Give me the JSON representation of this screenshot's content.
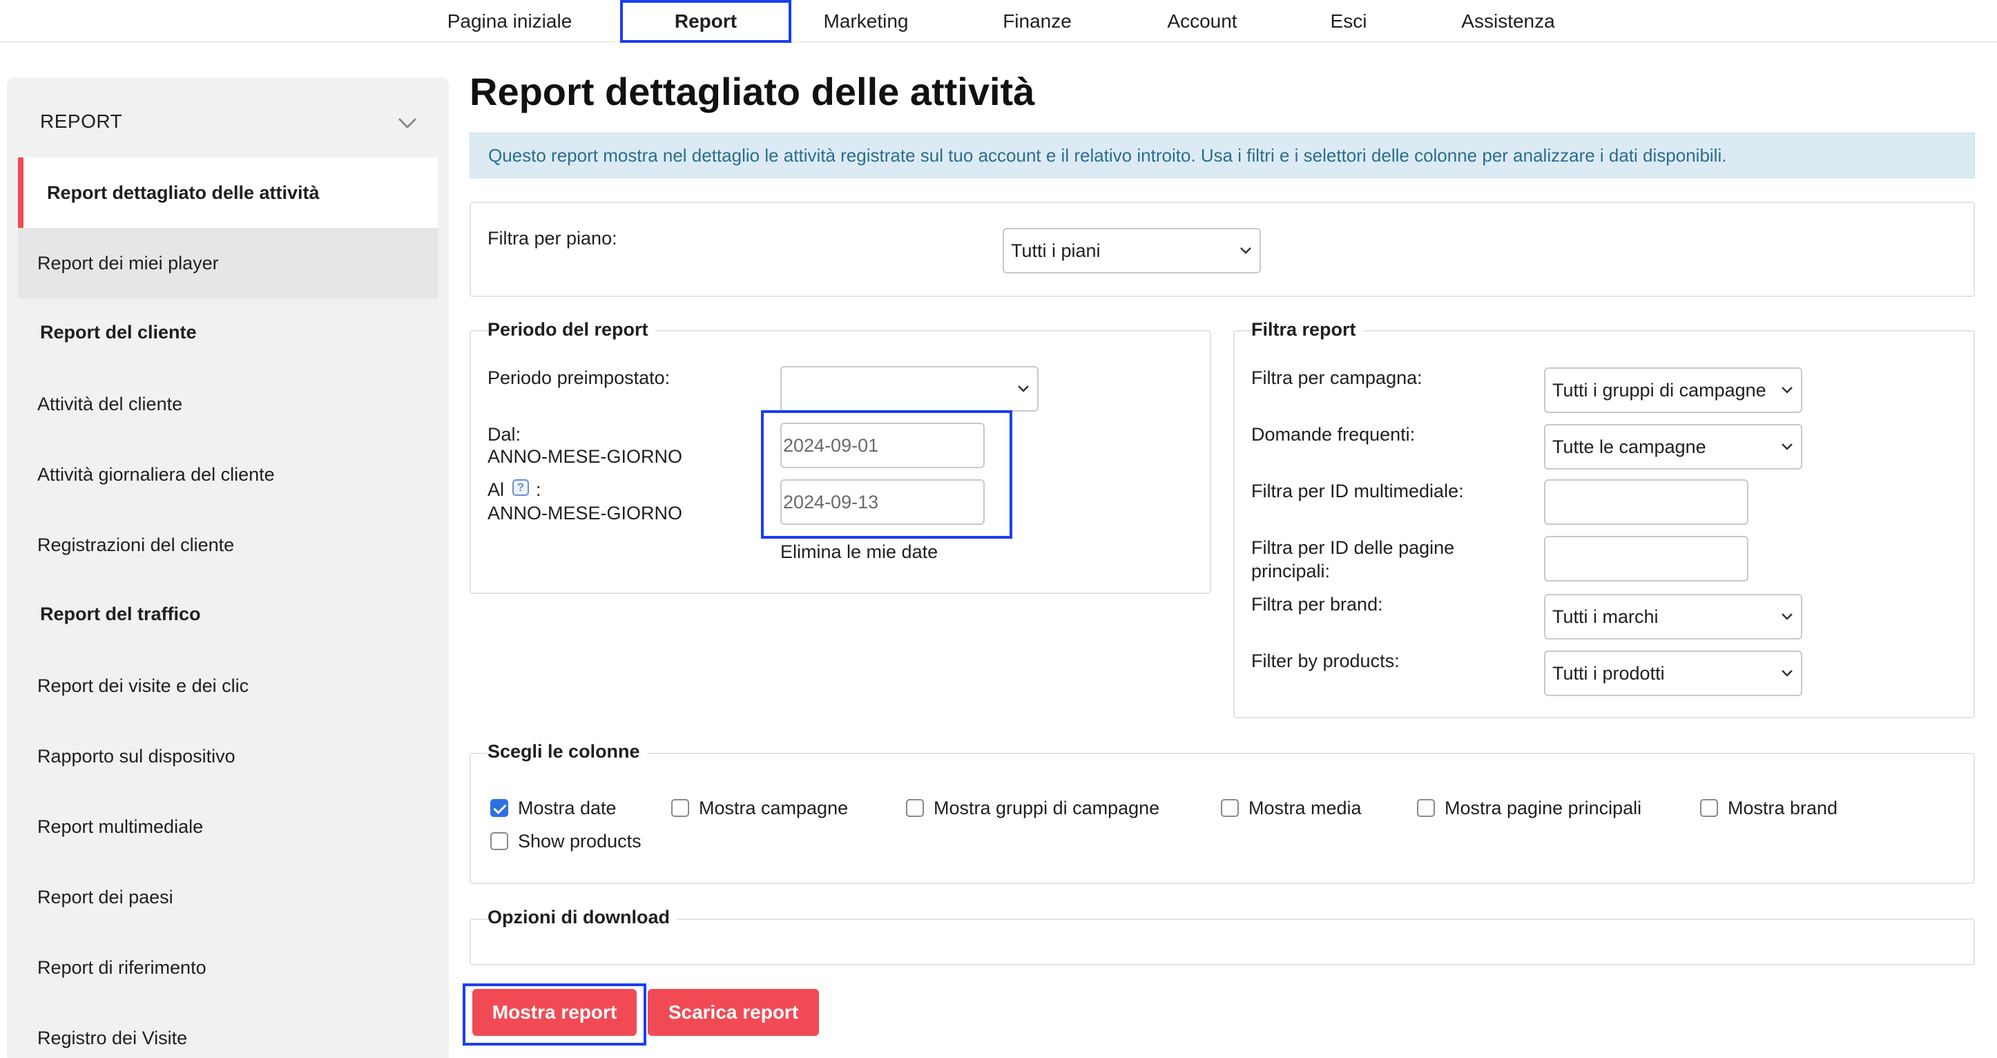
{
  "topnav": {
    "items": [
      "Pagina iniziale",
      "Report",
      "Marketing",
      "Finanze",
      "Account",
      "Esci",
      "Assistenza"
    ],
    "active": "Report"
  },
  "sidebar": {
    "header": "REPORT",
    "items": [
      {
        "label": "Report dettagliato delle attività"
      },
      {
        "label": "Report dei miei player"
      },
      {
        "label": "Report del cliente"
      },
      {
        "label": "Attività del cliente"
      },
      {
        "label": "Attività giornaliera del cliente"
      },
      {
        "label": "Registrazioni del cliente"
      },
      {
        "label": "Report del traffico"
      },
      {
        "label": "Report dei visite e dei clic"
      },
      {
        "label": "Rapporto sul dispositivo"
      },
      {
        "label": "Report multimediale"
      },
      {
        "label": "Report dei paesi"
      },
      {
        "label": "Report di riferimento"
      },
      {
        "label": "Registro dei Visite"
      }
    ]
  },
  "main": {
    "title": "Report dettagliato delle attività",
    "info": "Questo report mostra nel dettaglio le attività registrate sul tuo account e il relativo introito. Usa i filtri e i selettori delle colonne per analizzare i dati disponibili.",
    "plan_filter": {
      "label": "Filtra per piano:",
      "value": "Tutti i piani"
    },
    "period": {
      "legend": "Periodo del report",
      "preset_label": "Periodo preimpostato:",
      "preset_value": "",
      "from_label": "Dal:",
      "from_format": "ANNO-MESE-GIORNO",
      "from_value": "2024-09-01",
      "to_label": "Al",
      "to_colon": ":",
      "to_format": "ANNO-MESE-GIORNO",
      "to_value": "2024-09-13",
      "clear_label": "Elimina le mie date",
      "help_glyph": "?"
    },
    "filters": {
      "legend": "Filtra report",
      "campaign": {
        "label": "Filtra per campagna:",
        "value": "Tutti i gruppi di campagne"
      },
      "faq": {
        "label": "Domande frequenti:",
        "value": "Tutte le campagne"
      },
      "media_id": {
        "label": "Filtra per ID multimediale:",
        "value": ""
      },
      "landing_id": {
        "label_line1": "Filtra per ID delle pagine",
        "label_line2": "principali:",
        "value": ""
      },
      "brand": {
        "label": "Filtra per brand:",
        "value": "Tutti i marchi"
      },
      "products": {
        "label": "Filter by products:",
        "value": "Tutti i prodotti"
      }
    },
    "columns": {
      "legend": "Scegli le colonne",
      "options": [
        {
          "label": "Mostra date",
          "checked": true
        },
        {
          "label": "Mostra campagne",
          "checked": false
        },
        {
          "label": "Mostra gruppi di campagne",
          "checked": false
        },
        {
          "label": "Mostra media",
          "checked": false
        },
        {
          "label": "Mostra pagine principali",
          "checked": false
        },
        {
          "label": "Mostra brand",
          "checked": false
        },
        {
          "label": "Show products",
          "checked": false
        }
      ]
    },
    "download": {
      "legend": "Opzioni di download"
    },
    "buttons": {
      "show": "Mostra report",
      "download": "Scarica report"
    }
  },
  "colors": {
    "accent": "#f24a55",
    "highlight": "#1a3ff0",
    "info_bg": "#dcebf3",
    "info_text": "#2a6d8f",
    "checkbox": "#2f6fe4"
  }
}
